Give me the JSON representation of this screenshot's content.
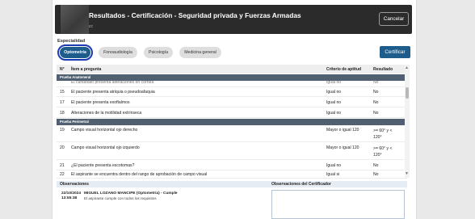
{
  "header": {
    "title": "Resultados - Certificación - Seguridad privada y Fuerzas Armadas",
    "subtitle": "cc",
    "cancel_label": "Cancelar"
  },
  "specialty": {
    "label": "Especialidad",
    "tabs": [
      "Optometría",
      "Fonoaudiología",
      "Psicología",
      "Medicina general"
    ],
    "active": "Optometría"
  },
  "certify_label": "Certificar",
  "table": {
    "headers": {
      "no": "N°",
      "item": "Ítem a pregunta",
      "criteria": "Criterio de aptitud",
      "result": "Resultado"
    },
    "sections": [
      {
        "name": "Prueba Anatomeral",
        "rows": [
          {
            "no": "",
            "item": "El candidato presenta alteraciones en cornea",
            "criteria": "Igual no",
            "result": "No"
          },
          {
            "no": "15",
            "item": "El paciente presenta atriquia o pseudoafaquia",
            "criteria": "Igual no",
            "result": "No"
          },
          {
            "no": "17",
            "item": "El paciente presenta exoftalmos",
            "criteria": "Igual no",
            "result": "No"
          },
          {
            "no": "18",
            "item": "Alteraciones de la motilidad extrínseca",
            "criteria": "Igual no",
            "result": "No"
          }
        ]
      },
      {
        "name": "Prueba Perimetral",
        "rows": [
          {
            "no": "19",
            "item": "Campo visual horizontal ojo derecho",
            "criteria": "Mayor o igual 120",
            "result": ">= 60° y < 120°"
          },
          {
            "no": "20",
            "item": "Campo visual horizontal ojo izquierdo",
            "criteria": "Mayor o igual 120",
            "result": ">= 60° y < 120°"
          },
          {
            "no": "21",
            "item": "¿El paciente presenta escotomas?",
            "criteria": "Igual no",
            "result": "No"
          },
          {
            "no": "22",
            "item": "El aspirante se encuentra dentro del rango de aprobación de campo visual",
            "criteria": "Igual si",
            "result": "No"
          }
        ]
      }
    ]
  },
  "observations": {
    "label": "Observaciones",
    "certifier_label": "Observaciones del Certificador",
    "date": "22/10/2024",
    "time": "13:55:38",
    "author": "MIGUEL LOZANO MANCIPE (Optometría) - Cumple",
    "text": "El aspirante cumple con todos los requisitos"
  }
}
